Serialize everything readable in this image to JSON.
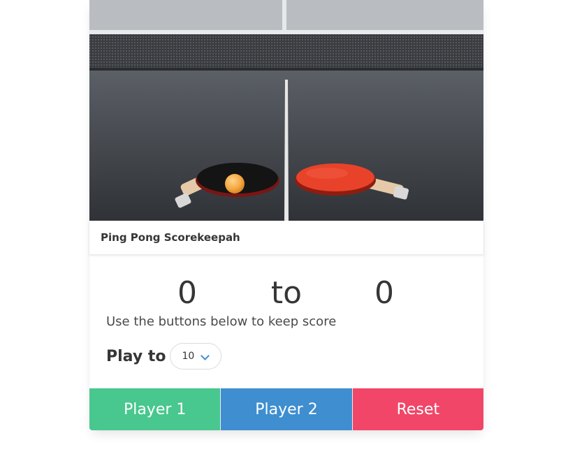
{
  "header": {
    "title": "Ping Pong Scorekeepah"
  },
  "image": {
    "subject": "ping-pong-paddles-on-table-image"
  },
  "scoreboard": {
    "player1_score": "0",
    "separator": "to",
    "player2_score": "0",
    "instructions": "Use the buttons below to keep score"
  },
  "play_to": {
    "label": "Play to",
    "selected": "10"
  },
  "footer": {
    "player1_label": "Player 1",
    "player2_label": "Player 2",
    "reset_label": "Reset"
  },
  "colors": {
    "player1": "#48c78e",
    "player2": "#3e8ed0",
    "reset": "#f14668"
  }
}
